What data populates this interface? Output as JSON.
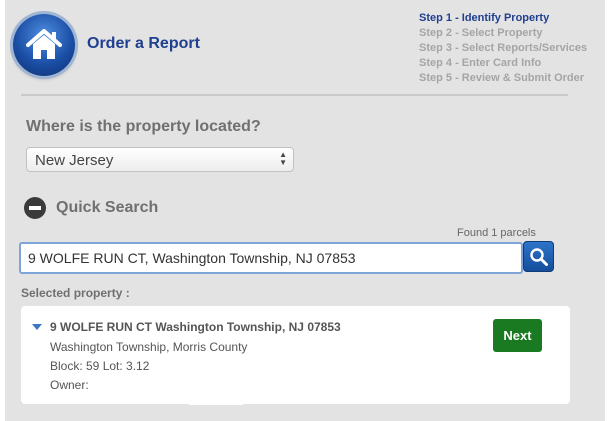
{
  "header": {
    "title": "Order a Report",
    "logo_icon": "home-icon"
  },
  "steps": [
    {
      "label": "Step 1 - Identify Property",
      "active": true
    },
    {
      "label": "Step 2 - Select Property",
      "active": false
    },
    {
      "label": "Step 3 - Select Reports/Services",
      "active": false
    },
    {
      "label": "Step 4 - Enter Card Info",
      "active": false
    },
    {
      "label": "Step 5 - Review & Submit Order",
      "active": false
    }
  ],
  "location": {
    "question": "Where is the property located?",
    "state_value": "New Jersey"
  },
  "quick_search": {
    "label": "Quick Search",
    "toggle_icon": "minus-circle-icon",
    "found_text": "Found 1 parcels",
    "input_value": "9 WOLFE RUN CT, Washington Township, NJ 07853",
    "button_icon": "search-icon"
  },
  "selected": {
    "label": "Selected property :",
    "address": "9 WOLFE RUN CT Washington Township, NJ 07853",
    "municipality": "Washington Township, Morris County",
    "block_lot": "Block: 59 Lot: 3.12",
    "owner": "Owner:",
    "next_label": "Next"
  },
  "colors": {
    "accent": "#1f3f8f",
    "next_button": "#1a7a21",
    "search_button": "#1f5fb0"
  }
}
